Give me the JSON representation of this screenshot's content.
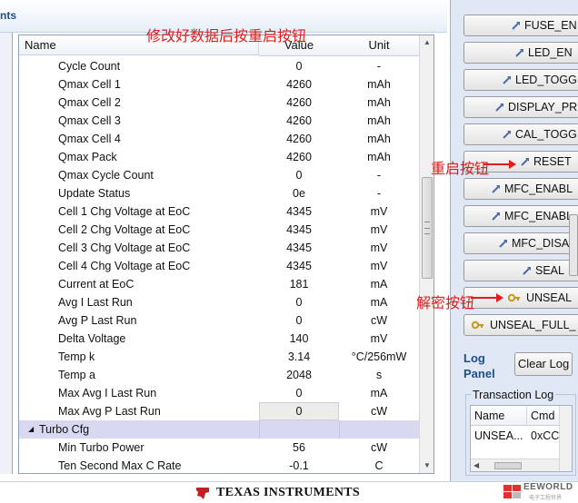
{
  "left_panel": {
    "title_fragment": "nts"
  },
  "grid": {
    "columns": [
      "Name",
      "Value",
      "Unit"
    ],
    "rows": [
      {
        "name": "Cycle Count",
        "value": "0",
        "unit": "-"
      },
      {
        "name": "Qmax Cell 1",
        "value": "4260",
        "unit": "mAh"
      },
      {
        "name": "Qmax Cell 2",
        "value": "4260",
        "unit": "mAh"
      },
      {
        "name": "Qmax Cell 3",
        "value": "4260",
        "unit": "mAh"
      },
      {
        "name": "Qmax Cell 4",
        "value": "4260",
        "unit": "mAh"
      },
      {
        "name": "Qmax Pack",
        "value": "4260",
        "unit": "mAh"
      },
      {
        "name": "Qmax Cycle Count",
        "value": "0",
        "unit": "-"
      },
      {
        "name": "Update Status",
        "value": "0e",
        "unit": "-"
      },
      {
        "name": "Cell 1 Chg Voltage at EoC",
        "value": "4345",
        "unit": "mV"
      },
      {
        "name": "Cell 2 Chg Voltage at EoC",
        "value": "4345",
        "unit": "mV"
      },
      {
        "name": "Cell 3 Chg Voltage at EoC",
        "value": "4345",
        "unit": "mV"
      },
      {
        "name": "Cell 4 Chg Voltage at EoC",
        "value": "4345",
        "unit": "mV"
      },
      {
        "name": "Current at EoC",
        "value": "181",
        "unit": "mA"
      },
      {
        "name": "Avg I Last Run",
        "value": "0",
        "unit": "mA"
      },
      {
        "name": "Avg P Last Run",
        "value": "0",
        "unit": "cW"
      },
      {
        "name": "Delta Voltage",
        "value": "140",
        "unit": "mV"
      },
      {
        "name": "Temp k",
        "value": "3.14",
        "unit": "°C/256mW"
      },
      {
        "name": "Temp a",
        "value": "2048",
        "unit": "s"
      },
      {
        "name": "Max Avg I Last Run",
        "value": "0",
        "unit": "mA"
      },
      {
        "name": "Max Avg P Last Run",
        "value": "0",
        "unit": "cW"
      }
    ],
    "group": {
      "name": "Turbo Cfg",
      "expander": "◢"
    },
    "rows2": [
      {
        "name": "Min Turbo Power",
        "value": "56",
        "unit": "cW"
      },
      {
        "name": "Ten Second Max C Rate",
        "value": "-0.1",
        "unit": "C"
      }
    ]
  },
  "commands": [
    {
      "label": "FUSE_EN"
    },
    {
      "label": "LED_EN"
    },
    {
      "label": "LED_TOGG"
    },
    {
      "label": "DISPLAY_PR"
    },
    {
      "label": "CAL_TOGG"
    },
    {
      "label": "RESET"
    },
    {
      "label": "MFC_ENABL"
    },
    {
      "label": "MFC_ENABL"
    },
    {
      "label": "MFC_DISAI"
    },
    {
      "label": "SEAL"
    },
    {
      "label": "UNSEAL"
    },
    {
      "label": "UNSEAL_FULL_"
    }
  ],
  "log": {
    "panel_label": "Log Panel",
    "clear_label": "Clear Log",
    "transaction_label": "Transaction Log",
    "columns": [
      "Name",
      "Cmd"
    ],
    "row": [
      "UNSEA...",
      "0xCC"
    ]
  },
  "annotations": {
    "top_note": "修改好数据后按重启按钮",
    "reset_note": "重启按钮",
    "unseal_note": "解密按钮"
  },
  "footer": {
    "brand": "TEXAS INSTRUMENTS",
    "watermark": "EEWORLD",
    "watermark_sub": "电子工程世界"
  },
  "colors": {
    "group_row": "#d8d8f0",
    "annotation": "#e21b1b",
    "panel_bg": "#dfe8f4"
  }
}
